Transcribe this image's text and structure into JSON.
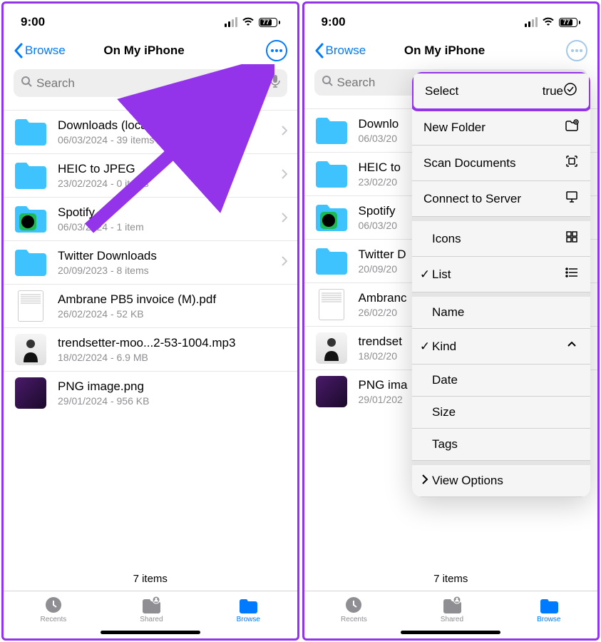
{
  "status": {
    "time": "9:00",
    "battery": "77"
  },
  "header": {
    "back_label": "Browse",
    "title": "On My iPhone"
  },
  "search": {
    "placeholder": "Search"
  },
  "files": [
    {
      "name": "Downloads (local)",
      "meta": "06/03/2024 - 39 items",
      "type": "folder"
    },
    {
      "name": "HEIC to JPEG",
      "meta": "23/02/2024 - 0 items",
      "type": "folder"
    },
    {
      "name": "Spotify",
      "meta": "06/03/2024 - 1 item",
      "type": "folder-spotify"
    },
    {
      "name": "Twitter Downloads",
      "meta": "20/09/2023 - 8 items",
      "type": "folder"
    },
    {
      "name": "Ambrane PB5 invoice (M).pdf",
      "meta": "26/02/2024 - 52 KB",
      "type": "pdf"
    },
    {
      "name": "trendsetter-moo...2-53-1004.mp3",
      "meta": "18/02/2024 - 6.9 MB",
      "type": "audio"
    },
    {
      "name": "PNG image.png",
      "meta": "29/01/2024 - 956 KB",
      "type": "image"
    }
  ],
  "files_truncated": [
    {
      "name": "Downlo",
      "meta": "06/03/20"
    },
    {
      "name": "HEIC to",
      "meta": "23/02/20"
    },
    {
      "name": "Spotify",
      "meta": "06/03/20"
    },
    {
      "name": "Twitter D",
      "meta": "20/09/20"
    },
    {
      "name": "Ambranc",
      "meta": "26/02/20"
    },
    {
      "name": "trendset",
      "meta": "18/02/20"
    },
    {
      "name": "PNG ima",
      "meta": "29/01/202"
    }
  ],
  "footer": {
    "count": "7 items"
  },
  "tabs": {
    "recents": "Recents",
    "shared": "Shared",
    "browse": "Browse"
  },
  "menu": {
    "select": "Select",
    "new_folder": "New Folder",
    "scan": "Scan Documents",
    "connect": "Connect to Server",
    "icons": "Icons",
    "list": "List",
    "name": "Name",
    "kind": "Kind",
    "date": "Date",
    "size": "Size",
    "tags": "Tags",
    "view_options": "View Options"
  }
}
